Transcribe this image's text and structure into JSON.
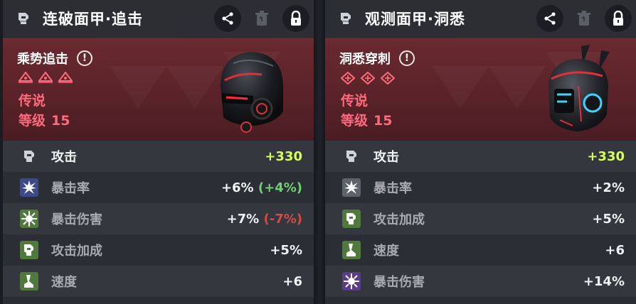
{
  "panels": [
    {
      "title": "连破面甲·追击",
      "set_name": "乘势追击",
      "info_label": "!",
      "rarity": "传说",
      "level_label": "等级",
      "level_value": "15",
      "stats": [
        {
          "name": "攻击",
          "value": "+330",
          "bonus": "",
          "icon": "fist-icon",
          "name_color": "white",
          "value_color": "green"
        },
        {
          "name": "暴击率",
          "value": "+6%",
          "bonus": "(+4%)",
          "bonus_type": "good",
          "icon": "crit-burst-icon",
          "name_color": "grey"
        },
        {
          "name": "暴击伤害",
          "value": "+7%",
          "bonus": "(-7%)",
          "bonus_type": "bad",
          "icon": "crit-damage-icon",
          "name_color": "grey"
        },
        {
          "name": "攻击加成",
          "value": "+5%",
          "bonus": "",
          "icon": "attack-bonus-icon",
          "name_color": "grey"
        },
        {
          "name": "速度",
          "value": "+6",
          "bonus": "",
          "icon": "speed-boot-icon",
          "name_color": "grey"
        }
      ]
    },
    {
      "title": "观测面甲·洞悉",
      "set_name": "洞悉穿刺",
      "info_label": "!",
      "rarity": "传说",
      "level_label": "等级",
      "level_value": "15",
      "stats": [
        {
          "name": "攻击",
          "value": "+330",
          "bonus": "",
          "icon": "fist-icon",
          "name_color": "white",
          "value_color": "green"
        },
        {
          "name": "暴击率",
          "value": "+2%",
          "bonus": "",
          "icon": "crit-burst-icon",
          "name_color": "grey"
        },
        {
          "name": "攻击加成",
          "value": "+5%",
          "bonus": "",
          "icon": "attack-bonus-icon",
          "name_color": "grey"
        },
        {
          "name": "速度",
          "value": "+6",
          "bonus": "",
          "icon": "speed-boot-icon",
          "name_color": "grey"
        },
        {
          "name": "暴击伤害",
          "value": "+14%",
          "bonus": "",
          "icon": "crit-damage-icon",
          "name_color": "grey"
        }
      ]
    }
  ],
  "colors": {
    "accent_rarity": "#ff6a7c",
    "main_stat_value": "#d6ff5a",
    "bonus_positive": "#6dd36d",
    "bonus_negative": "#d44a44",
    "hero_bg": "#5a2329"
  }
}
